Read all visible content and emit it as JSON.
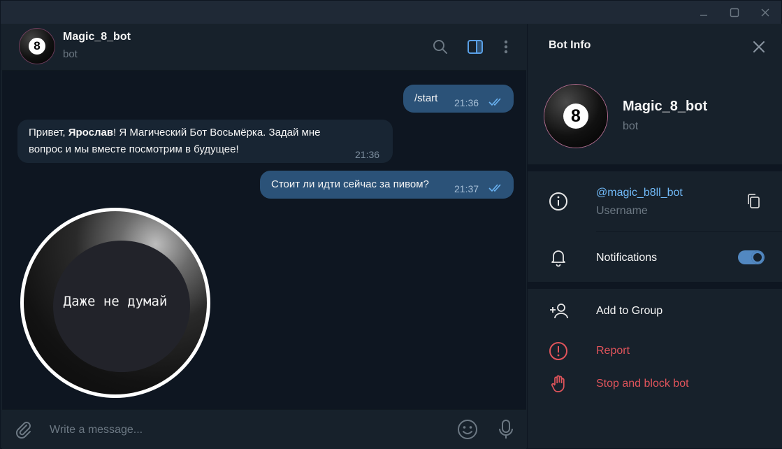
{
  "chat": {
    "title": "Magic_8_bot",
    "subtitle": "bot",
    "avatar_glyph": "8",
    "header_icons": [
      "search-icon",
      "sidebar-panel-icon",
      "more-vertical-icon"
    ]
  },
  "messages": [
    {
      "direction": "out",
      "text": "/start",
      "time": "21:36",
      "status": "read"
    },
    {
      "direction": "in",
      "text_prefix": "Привет, ",
      "text_bold": "Ярослав",
      "text_line1_rest": "! Я Магический Бот Восьмёрка. Задай мне",
      "text_line2": "вопрос и мы вместе посмотрим в будущее!",
      "time": "21:36"
    },
    {
      "direction": "out",
      "text": "Стоит ли идти сейчас за пивом?",
      "time": "21:37",
      "status": "read"
    }
  ],
  "magic_ball": {
    "answer": "Даже не думай"
  },
  "composer": {
    "placeholder": "Write a message...",
    "icons": [
      "attach-icon",
      "emoji-icon",
      "microphone-icon"
    ]
  },
  "bot_info": {
    "title": "Bot Info",
    "name": "Magic_8_bot",
    "subtitle": "bot",
    "avatar_glyph": "8",
    "username": "@magic_b8ll_bot",
    "username_label": "Username",
    "notifications_label": "Notifications",
    "notifications_on": true,
    "add_to_group": "Add to Group",
    "report": "Report",
    "stop_block": "Stop and block bot"
  },
  "colors": {
    "background": "#0e1621",
    "panel": "#17212b",
    "outgoing_bubble": "#2b5278",
    "incoming_bubble": "#182533",
    "accent": "#5288c1",
    "link": "#71baf8",
    "danger": "#e0545b"
  }
}
